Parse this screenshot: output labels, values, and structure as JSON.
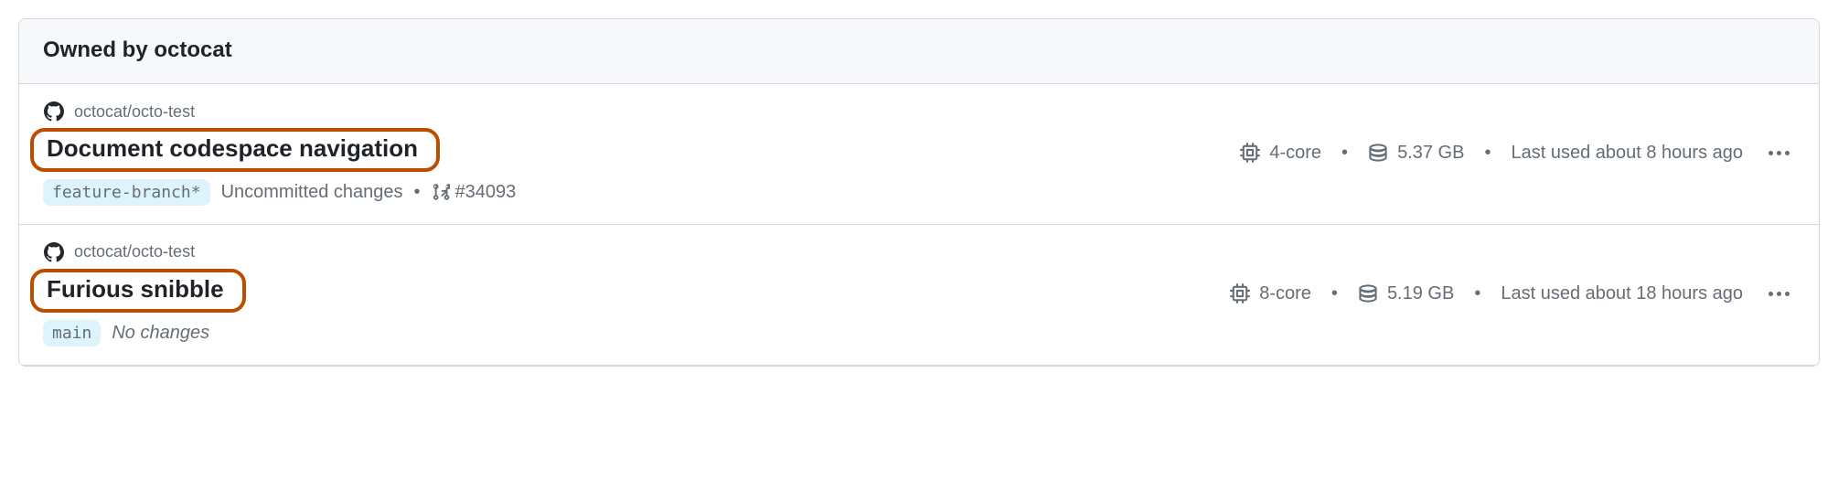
{
  "header": {
    "title": "Owned by octocat"
  },
  "items": [
    {
      "repo": "octocat/octo-test",
      "title": "Document codespace navigation",
      "branch": "feature-branch*",
      "status": "Uncommitted changes",
      "status_italic": false,
      "pr": "#34093",
      "cores": "4-core",
      "storage": "5.37 GB",
      "last_used": "Last used about 8 hours ago"
    },
    {
      "repo": "octocat/octo-test",
      "title": "Furious snibble",
      "branch": "main",
      "status": "No changes",
      "status_italic": true,
      "pr": "",
      "cores": "8-core",
      "storage": "5.19 GB",
      "last_used": "Last used about 18 hours ago"
    }
  ]
}
